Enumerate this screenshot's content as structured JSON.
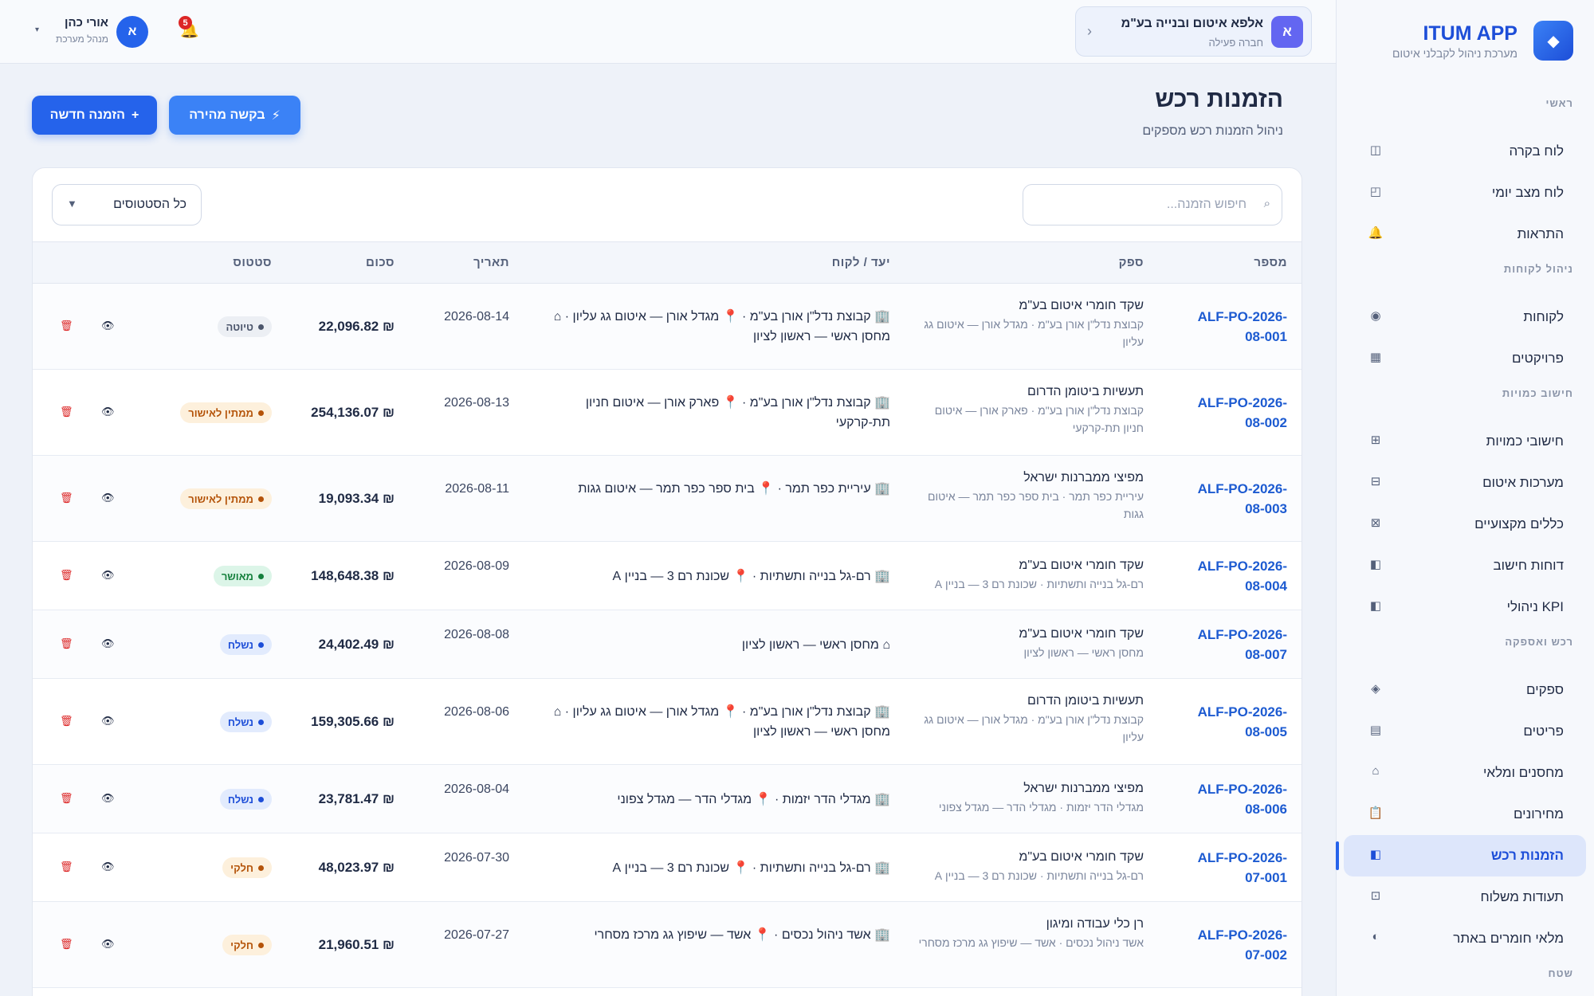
{
  "brand": {
    "name": "ITUM APP",
    "subtitle": "מערכת ניהול לקבלני איטום",
    "logo_icon": "◆"
  },
  "nav": [
    {
      "type": "section",
      "label": "ראשי"
    },
    {
      "type": "item",
      "label": "לוח בקרה",
      "icon": "◫",
      "name": "dashboard"
    },
    {
      "type": "item",
      "label": "לוח מצב יומי",
      "icon": "◰",
      "name": "daily-status"
    },
    {
      "type": "item",
      "label": "התראות",
      "icon": "🔔",
      "name": "alerts"
    },
    {
      "type": "section",
      "label": "ניהול לקוחות"
    },
    {
      "type": "item",
      "label": "לקוחות",
      "icon": "◉",
      "name": "customers"
    },
    {
      "type": "item",
      "label": "פרויקטים",
      "icon": "▦",
      "name": "projects"
    },
    {
      "type": "section",
      "label": "חישוב כמויות"
    },
    {
      "type": "item",
      "label": "חישובי כמויות",
      "icon": "⊞",
      "name": "quantity-calcs"
    },
    {
      "type": "item",
      "label": "מערכות איטום",
      "icon": "⊟",
      "name": "sealing-systems"
    },
    {
      "type": "item",
      "label": "כללים מקצועיים",
      "icon": "⊠",
      "name": "professional-rules"
    },
    {
      "type": "item",
      "label": "דוחות חישוב",
      "icon": "◧",
      "name": "calc-reports"
    },
    {
      "type": "item",
      "label": "KPI ניהולי",
      "icon": "◧",
      "name": "management-kpi"
    },
    {
      "type": "section",
      "label": "רכש ואספקה"
    },
    {
      "type": "item",
      "label": "ספקים",
      "icon": "◈",
      "name": "suppliers"
    },
    {
      "type": "item",
      "label": "פריטים",
      "icon": "▤",
      "name": "items"
    },
    {
      "type": "item",
      "label": "מחסנים ומלאי",
      "icon": "⌂",
      "name": "warehouses"
    },
    {
      "type": "item",
      "label": "מחירונים",
      "icon": "📋",
      "name": "price-lists"
    },
    {
      "type": "item",
      "label": "הזמנות רכש",
      "icon": "◧",
      "name": "purchase-orders",
      "active": true
    },
    {
      "type": "item",
      "label": "תעודות משלוח",
      "icon": "⊡",
      "name": "delivery-notes"
    },
    {
      "type": "item",
      "label": "מלאי חומרים באתר",
      "icon": "◐",
      "name": "site-inventory"
    },
    {
      "type": "section",
      "label": "שטח"
    }
  ],
  "header": {
    "company": {
      "avatar": "א",
      "name": "אלפא איטום ובנייה בע\"מ",
      "type": "חברה פעילה",
      "chevron": "‹"
    },
    "user": {
      "avatar": "א",
      "name": "אורי כהן",
      "role": "מנהל מערכת",
      "caret": "▾"
    },
    "notifications": {
      "icon": "🔔",
      "count": "5"
    }
  },
  "page": {
    "title": "הזמנות רכש",
    "subtitle": "ניהול הזמנות רכש מספקים",
    "new_button": "הזמנה חדשה",
    "new_button_icon": "+",
    "quick_button": "בקשה מהירה",
    "quick_button_icon": "⚡"
  },
  "toolbar": {
    "search_placeholder": "חיפוש הזמנה...",
    "search_icon": "⌕",
    "status_filter": "כל הסטטוסים",
    "status_caret": "▼"
  },
  "table": {
    "columns": {
      "number": "מספר",
      "supplier": "ספק",
      "destination": "יעד / לקוח",
      "date": "תאריך",
      "amount": "סכום",
      "status": "סטטוס"
    },
    "view_icon": "👁",
    "delete_icon": "🗑",
    "rows": [
      {
        "number": "ALF-PO-2026-08-001",
        "supplier": "שקד חומרי איטום בע\"מ",
        "project": "קבוצת נדל\"ן אורן בע\"מ · מגדל אורן — איטום גג עליון",
        "destination": "🏢 קבוצת נדל\"ן אורן בע\"מ · 📍 מגדל אורן — איטום גג עליון · ⌂ מחסן ראשי — ראשון לציון",
        "date": "2026-08-14",
        "amount": "₪ 22,096.82",
        "status": "טיוטה",
        "status_key": "draft",
        "height": 108
      },
      {
        "number": "ALF-PO-2026-08-002",
        "supplier": "תעשיות ביטומן הדרום",
        "project": "קבוצת נדל\"ן אורן בע\"מ · פארק אורן — איטום חניון תת-קרקעי",
        "destination": "🏢 קבוצת נדל\"ן אורן בע\"מ · 📍 פארק אורן — איטום חניון תת-קרקעי",
        "date": "2026-08-13",
        "amount": "₪ 254,136.07",
        "status": "ממתין לאישור",
        "status_key": "pending",
        "height": 108
      },
      {
        "number": "ALF-PO-2026-08-003",
        "supplier": "מפיצי ממברנות ישראל",
        "project": "עיריית כפר תמר · בית ספר כפר תמר — איטום גגות",
        "destination": "🏢 עיריית כפר תמר · 📍 בית ספר כפר תמר — איטום גגות",
        "date": "2026-08-11",
        "amount": "₪ 19,093.34",
        "status": "ממתין לאישור",
        "status_key": "pending",
        "height": 108
      },
      {
        "number": "ALF-PO-2026-08-004",
        "supplier": "שקד חומרי איטום בע\"מ",
        "project": "רם-גל בנייה ותשתיות · שכונת רם 3 — בניין A",
        "destination": "🏢 רם-גל בנייה ותשתיות · 📍 שכונת רם 3 — בניין A",
        "date": "2026-08-09",
        "amount": "₪ 148,648.38",
        "status": "מאושר",
        "status_key": "approved",
        "height": 86
      },
      {
        "number": "ALF-PO-2026-08-007",
        "supplier": "שקד חומרי איטום בע\"מ",
        "project": "מחסן ראשי — ראשון לציון",
        "destination": "⌂ מחסן ראשי — ראשון לציון",
        "date": "2026-08-08",
        "amount": "₪ 24,402.49",
        "status": "נשלח",
        "status_key": "sent",
        "height": 86
      },
      {
        "number": "ALF-PO-2026-08-005",
        "supplier": "תעשיות ביטומן הדרום",
        "project": "קבוצת נדל\"ן אורן בע\"מ · מגדל אורן — איטום גג עליון",
        "destination": "🏢 קבוצת נדל\"ן אורן בע\"מ · 📍 מגדל אורן — איטום גג עליון · ⌂ מחסן ראשי — ראשון לציון",
        "date": "2026-08-06",
        "amount": "₪ 159,305.66",
        "status": "נשלח",
        "status_key": "sent",
        "height": 108
      },
      {
        "number": "ALF-PO-2026-08-006",
        "supplier": "מפיצי ממברנות ישראל",
        "project": "מגדלי הדר יזמות · מגדלי הדר — מגדל צפוני",
        "destination": "🏢 מגדלי הדר יזמות · 📍 מגדלי הדר — מגדל צפוני",
        "date": "2026-08-04",
        "amount": "₪ 23,781.47",
        "status": "נשלח",
        "status_key": "sent",
        "height": 86
      },
      {
        "number": "ALF-PO-2026-07-001",
        "supplier": "שקד חומרי איטום בע\"מ",
        "project": "רם-גל בנייה ותשתיות · שכונת רם 3 — בניין A",
        "destination": "🏢 רם-גל בנייה ותשתיות · 📍 שכונת רם 3 — בניין A",
        "date": "2026-07-30",
        "amount": "₪ 48,023.97",
        "status": "חלקי",
        "status_key": "partial",
        "height": 86
      },
      {
        "number": "ALF-PO-2026-07-002",
        "supplier": "רן כלי עבודה ומיגון",
        "project": "אשד ניהול נכסים · אשד — שיפוץ גג מרכז מסחרי",
        "destination": "🏢 אשד ניהול נכסים · 📍 אשד — שיפוץ גג מרכז מסחרי",
        "date": "2026-07-27",
        "amount": "₪ 21,960.51",
        "status": "חלקי",
        "status_key": "partial",
        "height": 108
      }
    ]
  }
}
